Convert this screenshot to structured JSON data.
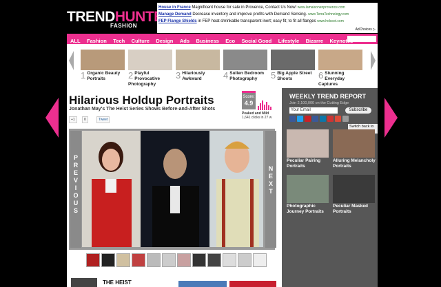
{
  "brand": {
    "part1": "TREND",
    "part2": "HUNTER",
    "tm": "™",
    "sub": "FASHION"
  },
  "ad": {
    "lines": [
      {
        "title": "House in France",
        "text": "Magnificent house for sale in Provence, Contact Us Now!",
        "url": "www.lamaisonenprovence.com"
      },
      {
        "title": "Manage Demand",
        "text": "Decrease inventory and improve profits with Demand Sensing.",
        "url": "www.TerraTechnology.com"
      },
      {
        "title": "FEP Flange Shields",
        "text": "in FEP heat shrinkable transparent inert; easy fit; to fit all flanges",
        "url": "www.holscot.com"
      }
    ],
    "adchoices": "AdChoices ▷"
  },
  "nav": [
    "ALL",
    "Fashion",
    "Tech",
    "Culture",
    "Design",
    "Ads",
    "Business",
    "Eco",
    "Social Good",
    "Lifestyle",
    "Bizarre",
    "Keynotes"
  ],
  "carousel": [
    {
      "n": "1",
      "label": "Organic Beauty Portraits",
      "color": "#b89a7a"
    },
    {
      "n": "2",
      "label": "Playful Provocative Photography",
      "color": "#d8cfc4"
    },
    {
      "n": "3",
      "label": "Hilariously Awkward",
      "color": "#c8b8a0"
    },
    {
      "n": "4",
      "label": "Sullen Bedroom Photography",
      "color": "#8a8a8a"
    },
    {
      "n": "5",
      "label": "Big Apple Street Shoots",
      "color": "#6a6a6a"
    },
    {
      "n": "6",
      "label": "Stunning Everyday Captures",
      "color": "#c8a888"
    }
  ],
  "article": {
    "title": "Hilarious Holdup Portraits",
    "subtitle": "Jonathan May's The Heist Series Shows Before-and-After Shots",
    "score_label": "Score:",
    "score": "4.9",
    "peaked": "Peaked and Mild",
    "clicks": "1,641 clicks in 27 w",
    "gplus": "+1",
    "gcount": "0",
    "tweet": "Tweet",
    "previous": "PREVIOUS",
    "next": "NEXT",
    "related_title": "THE HEIST"
  },
  "sidebar": {
    "title": "WEEKLY TREND REPORT",
    "subtitle": "Join 2,100,000 on the Cutting Edge",
    "email_placeholder": "Your Email",
    "subscribe": "Subscribe",
    "switch": "Switch back to p",
    "social_colors": [
      "#3b5998",
      "#1da1f2",
      "#cb2027",
      "#3b5998",
      "#0e76a8",
      "#cc3333",
      "#dd4b39",
      "#999999"
    ],
    "items": [
      {
        "label": "Peculiar Pairing Portraits",
        "color": "#c9b8b0"
      },
      {
        "label": "Alluring Melancholy Portraits",
        "color": "#8a6a55"
      },
      {
        "label": "Photographic Journey Portraits",
        "color": "#7a8a7a"
      },
      {
        "label": "Peculiar Masked Portraits",
        "color": "#3a3a3a"
      }
    ]
  },
  "colors": {
    "accent": "#ed2f8f",
    "sidebar": "#575757"
  }
}
